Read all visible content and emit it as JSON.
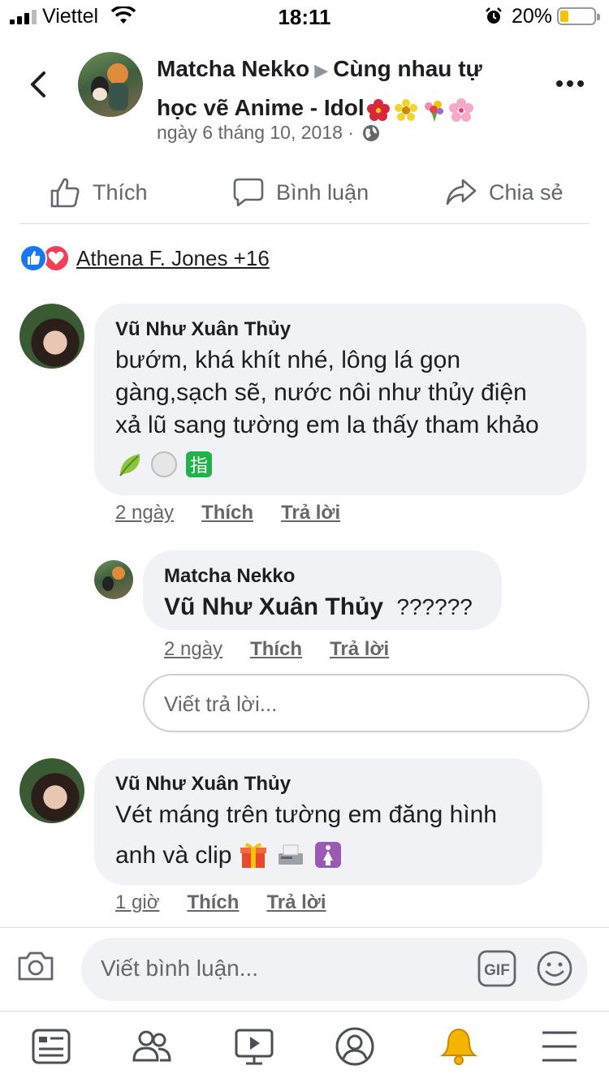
{
  "status_bar": {
    "carrier": "Viettel",
    "time": "18:11",
    "battery": "20%"
  },
  "post": {
    "author": "Matcha Nekko",
    "group": "Cùng nhau tự học vẽ Anime - Idol",
    "date": "ngày 6 tháng 10, 2018 ·"
  },
  "actions": {
    "like": "Thích",
    "comment": "Bình luận",
    "share": "Chia sẻ"
  },
  "reactions": {
    "names": "Athena F. Jones +16"
  },
  "comments": [
    {
      "name": "Vũ Như Xuân Thủy",
      "line1": "bướm, khá khít nhé, lông lá gọn",
      "line2": "gàng,sạch sẽ, nước nôi như thủy điện",
      "line3": "xả lũ sang tường em la thấy tham khảo",
      "time": "2 ngày",
      "like": "Thích",
      "reply": "Trả lời"
    },
    {
      "name": "Matcha Nekko",
      "mention": "Vũ Như Xuân Thủy",
      "text": "??????",
      "time": "2 ngày",
      "like": "Thích",
      "reply": "Trả lời"
    },
    {
      "name": "Vũ Như Xuân Thủy",
      "line1": "Vét máng trên tường em đăng hình",
      "line2": "anh và clip",
      "time": "1 giờ",
      "like": "Thích",
      "reply": "Trả lời"
    }
  ],
  "reply_placeholder": "Viết trả lời...",
  "composer": {
    "placeholder": "Viết bình luận..."
  },
  "tabs": [
    "news-feed-icon",
    "friends-icon",
    "watch-icon",
    "profile-icon",
    "notifications-icon",
    "menu-icon"
  ],
  "colors": {
    "accent": "#1877f2",
    "love": "#f33e58",
    "bell": "#f5b400",
    "bubble": "#f0f2f5"
  }
}
